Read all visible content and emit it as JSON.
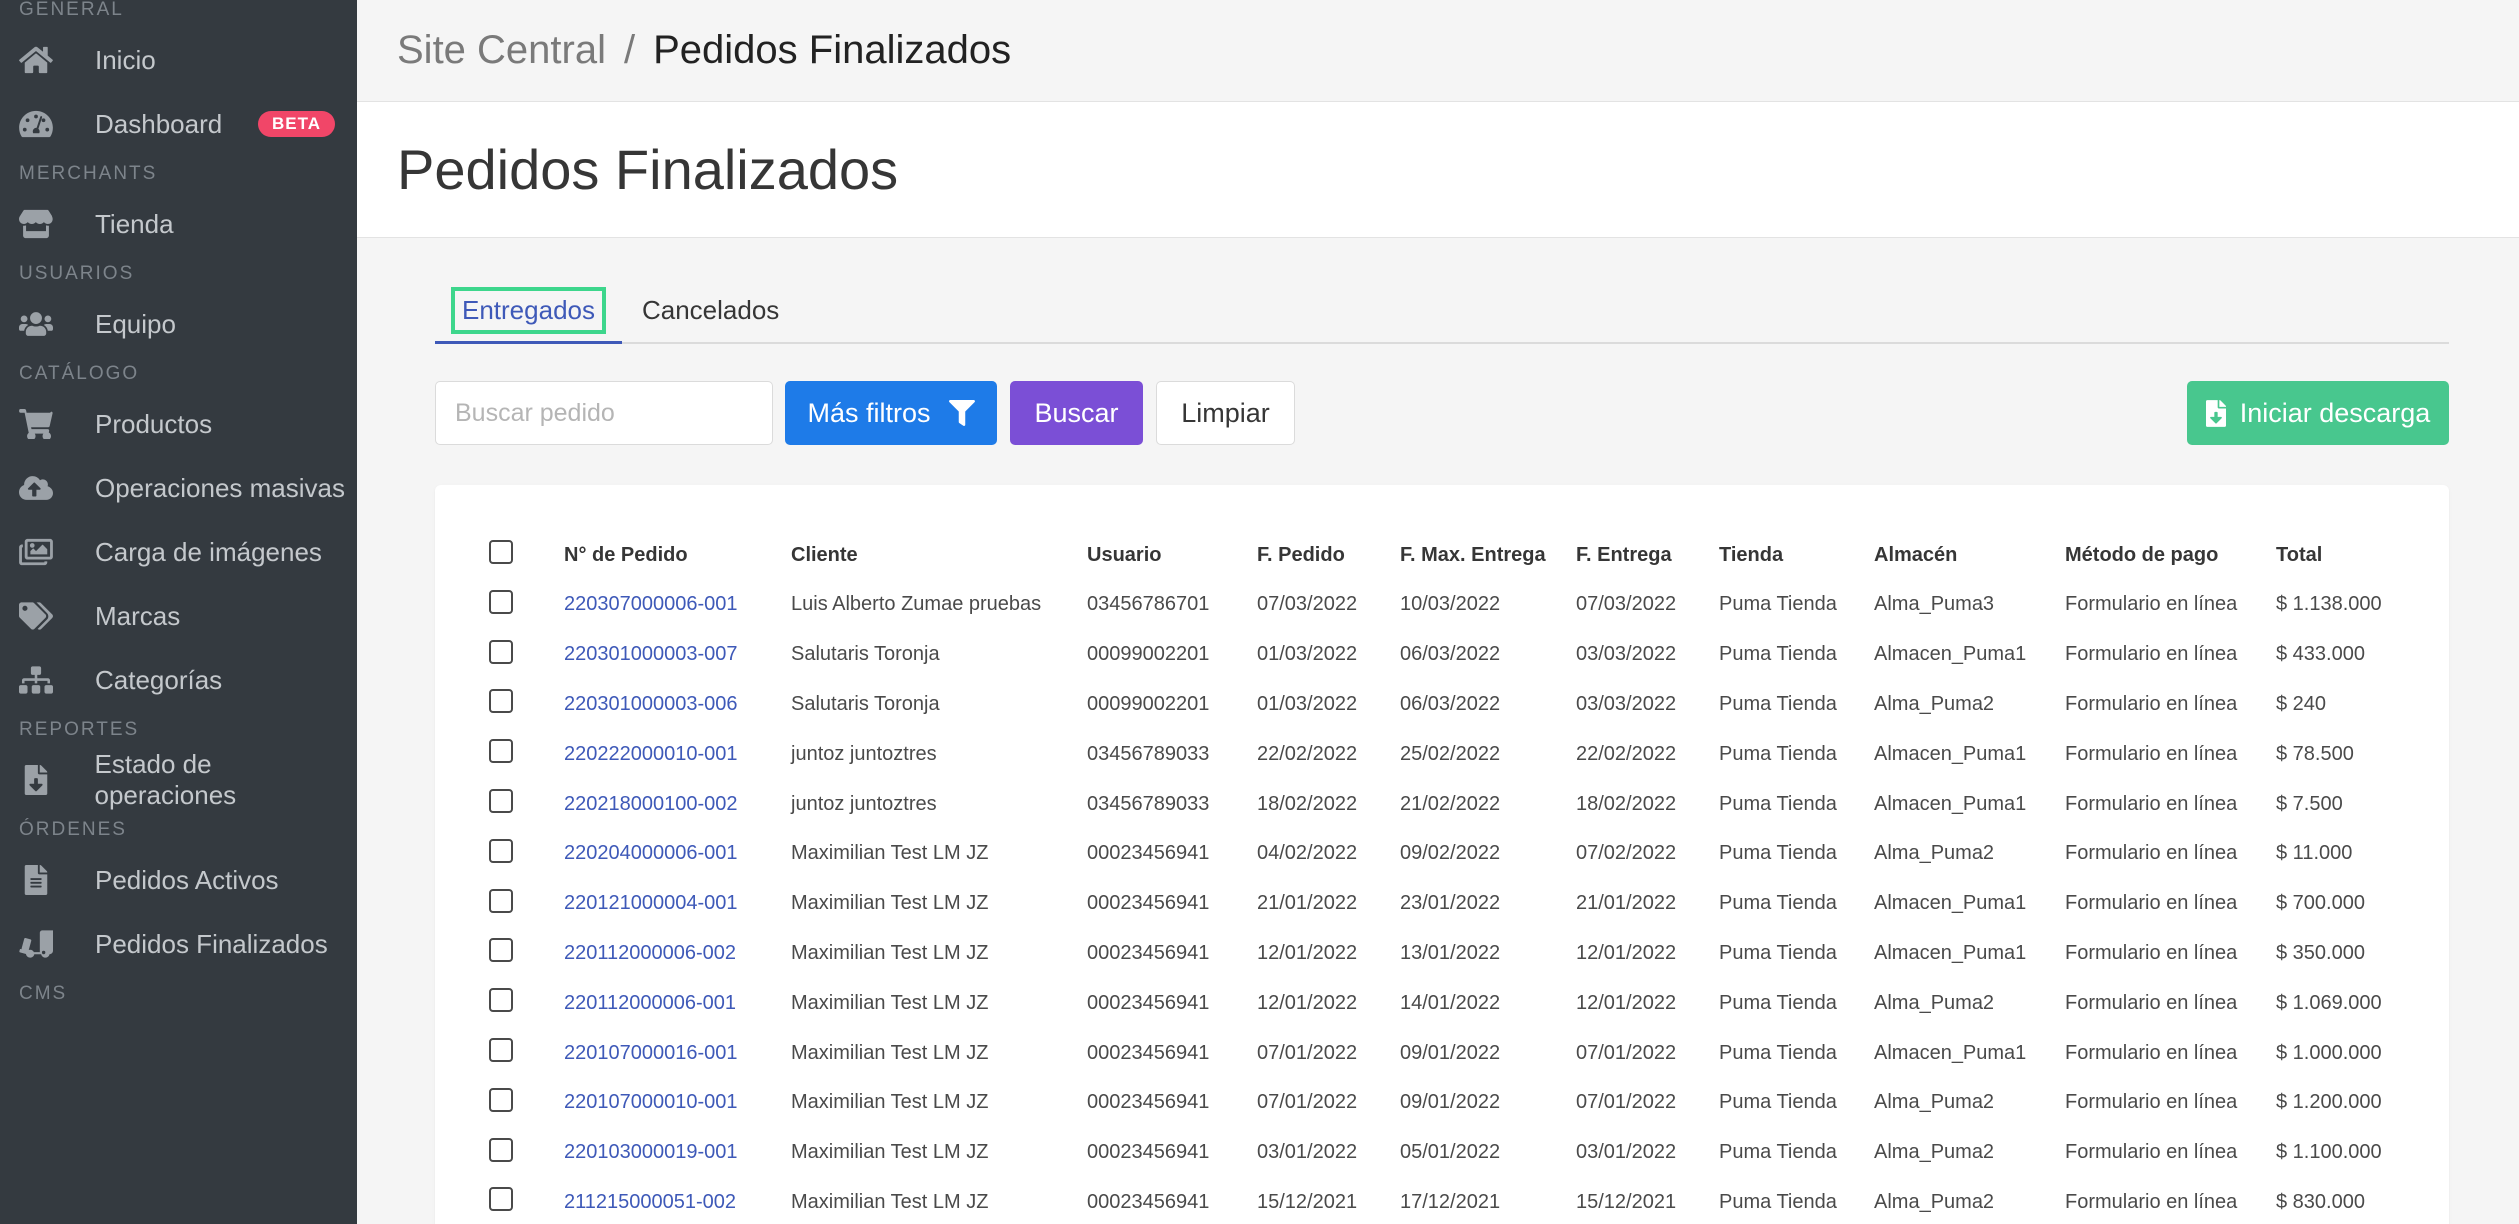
{
  "sidebar": {
    "sections": [
      {
        "title": "GENERAL",
        "items": [
          {
            "label": "Inicio",
            "icon": "home-icon"
          },
          {
            "label": "Dashboard",
            "icon": "dashboard-icon",
            "badge": "BETA"
          }
        ]
      },
      {
        "title": "MERCHANTS",
        "items": [
          {
            "label": "Tienda",
            "icon": "store-icon"
          }
        ]
      },
      {
        "title": "USUARIOS",
        "items": [
          {
            "label": "Equipo",
            "icon": "users-icon"
          }
        ]
      },
      {
        "title": "CATÁLOGO",
        "items": [
          {
            "label": "Productos",
            "icon": "cart-icon"
          },
          {
            "label": "Operaciones masivas",
            "icon": "cloud-upload-icon"
          },
          {
            "label": "Carga de imágenes",
            "icon": "images-icon"
          },
          {
            "label": "Marcas",
            "icon": "tags-icon"
          },
          {
            "label": "Categorías",
            "icon": "sitemap-icon"
          }
        ]
      },
      {
        "title": "REPORTES",
        "items": [
          {
            "label": "Estado de operaciones",
            "icon": "file-download-icon"
          }
        ]
      },
      {
        "title": "ÓRDENES",
        "items": [
          {
            "label": "Pedidos Activos",
            "icon": "file-list-icon"
          },
          {
            "label": "Pedidos Finalizados",
            "icon": "truck-loading-icon"
          }
        ]
      },
      {
        "title": "CMS",
        "items": []
      }
    ]
  },
  "breadcrumb": {
    "parent": "Site Central",
    "separator": "/",
    "current": "Pedidos Finalizados"
  },
  "page": {
    "title": "Pedidos Finalizados"
  },
  "tabs": [
    {
      "label": "Entregados",
      "active": true
    },
    {
      "label": "Cancelados",
      "active": false
    }
  ],
  "toolbar": {
    "search_placeholder": "Buscar pedido",
    "filters_label": "Más filtros",
    "search_label": "Buscar",
    "clear_label": "Limpiar",
    "download_label": "Iniciar descarga"
  },
  "table": {
    "columns": [
      "N° de Pedido",
      "Cliente",
      "Usuario",
      "F. Pedido",
      "F. Max. Entrega",
      "F. Entrega",
      "Tienda",
      "Almacén",
      "Método de pago",
      "Total"
    ],
    "rows": [
      [
        "220307000006-001",
        "Luis Alberto Zumae pruebas",
        "03456786701",
        "07/03/2022",
        "10/03/2022",
        "07/03/2022",
        "Puma Tienda",
        "Alma_Puma3",
        "Formulario en línea",
        "$ 1.138.000"
      ],
      [
        "220301000003-007",
        "Salutaris Toronja",
        "00099002201",
        "01/03/2022",
        "06/03/2022",
        "03/03/2022",
        "Puma Tienda",
        "Almacen_Puma1",
        "Formulario en línea",
        "$ 433.000"
      ],
      [
        "220301000003-006",
        "Salutaris Toronja",
        "00099002201",
        "01/03/2022",
        "06/03/2022",
        "03/03/2022",
        "Puma Tienda",
        "Alma_Puma2",
        "Formulario en línea",
        "$ 240"
      ],
      [
        "220222000010-001",
        "juntoz juntoztres",
        "03456789033",
        "22/02/2022",
        "25/02/2022",
        "22/02/2022",
        "Puma Tienda",
        "Almacen_Puma1",
        "Formulario en línea",
        "$ 78.500"
      ],
      [
        "220218000100-002",
        "juntoz juntoztres",
        "03456789033",
        "18/02/2022",
        "21/02/2022",
        "18/02/2022",
        "Puma Tienda",
        "Almacen_Puma1",
        "Formulario en línea",
        "$ 7.500"
      ],
      [
        "220204000006-001",
        "Maximilian Test LM JZ",
        "00023456941",
        "04/02/2022",
        "09/02/2022",
        "07/02/2022",
        "Puma Tienda",
        "Alma_Puma2",
        "Formulario en línea",
        "$ 11.000"
      ],
      [
        "220121000004-001",
        "Maximilian Test LM JZ",
        "00023456941",
        "21/01/2022",
        "23/01/2022",
        "21/01/2022",
        "Puma Tienda",
        "Almacen_Puma1",
        "Formulario en línea",
        "$ 700.000"
      ],
      [
        "220112000006-002",
        "Maximilian Test LM JZ",
        "00023456941",
        "12/01/2022",
        "13/01/2022",
        "12/01/2022",
        "Puma Tienda",
        "Almacen_Puma1",
        "Formulario en línea",
        "$ 350.000"
      ],
      [
        "220112000006-001",
        "Maximilian Test LM JZ",
        "00023456941",
        "12/01/2022",
        "14/01/2022",
        "12/01/2022",
        "Puma Tienda",
        "Alma_Puma2",
        "Formulario en línea",
        "$ 1.069.000"
      ],
      [
        "220107000016-001",
        "Maximilian Test LM JZ",
        "00023456941",
        "07/01/2022",
        "09/01/2022",
        "07/01/2022",
        "Puma Tienda",
        "Almacen_Puma1",
        "Formulario en línea",
        "$ 1.000.000"
      ],
      [
        "220107000010-001",
        "Maximilian Test LM JZ",
        "00023456941",
        "07/01/2022",
        "09/01/2022",
        "07/01/2022",
        "Puma Tienda",
        "Alma_Puma2",
        "Formulario en línea",
        "$ 1.200.000"
      ],
      [
        "220103000019-001",
        "Maximilian Test LM JZ",
        "00023456941",
        "03/01/2022",
        "05/01/2022",
        "03/01/2022",
        "Puma Tienda",
        "Alma_Puma2",
        "Formulario en línea",
        "$ 1.100.000"
      ],
      [
        "211215000051-002",
        "Maximilian Test LM JZ",
        "00023456941",
        "15/12/2021",
        "17/12/2021",
        "15/12/2021",
        "Puma Tienda",
        "Alma_Puma2",
        "Formulario en línea",
        "$ 830.000"
      ]
    ]
  },
  "colors": {
    "sidebar_bg": "#343a40",
    "link": "#3e59b8",
    "primary_button": "#1e7be8",
    "search_button": "#7b4fd6",
    "download_button": "#48c78e",
    "badge": "#f14668",
    "focus_outline": "#3dd68c"
  }
}
